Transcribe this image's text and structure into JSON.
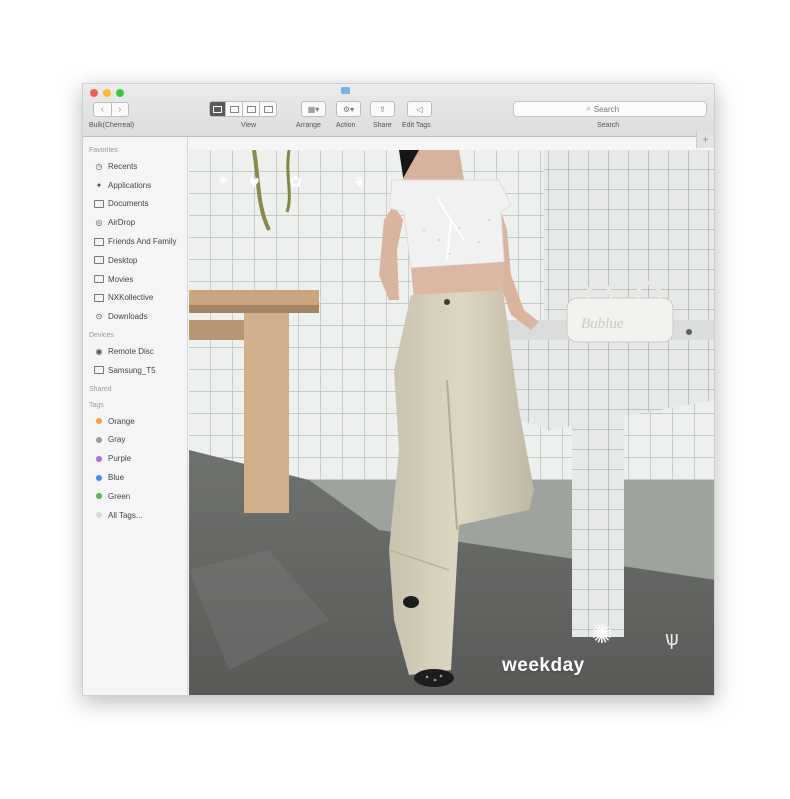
{
  "window": {
    "title": "Bulk(Cherreal)",
    "nav_back": "‹",
    "nav_forward": "›"
  },
  "toolbar": {
    "view_label": "View",
    "arrange_label": "Arrange",
    "action_label": "Action",
    "share_label": "Share",
    "edit_tags_label": "Edit Tags",
    "search_label": "Search",
    "search_placeholder": "Search"
  },
  "sidebar": {
    "favorites_header": "Favorites",
    "favorites": [
      {
        "label": "Recents",
        "icon": "clock-icon"
      },
      {
        "label": "Applications",
        "icon": "applications-icon"
      },
      {
        "label": "Documents",
        "icon": "documents-icon"
      },
      {
        "label": "AirDrop",
        "icon": "airdrop-icon"
      },
      {
        "label": "Friends And Family",
        "icon": "folder-icon"
      },
      {
        "label": "Desktop",
        "icon": "desktop-icon"
      },
      {
        "label": "Movies",
        "icon": "movies-icon"
      },
      {
        "label": "NXKollective",
        "icon": "folder-icon"
      },
      {
        "label": "Downloads",
        "icon": "downloads-icon"
      }
    ],
    "devices_header": "Devices",
    "devices": [
      {
        "label": "Remote Disc",
        "icon": "disc-icon"
      },
      {
        "label": "Samsung_T5",
        "icon": "drive-icon"
      }
    ],
    "shared_header": "Shared",
    "tags_header": "Tags",
    "tags": [
      {
        "label": "Orange",
        "color": "#f0a33a"
      },
      {
        "label": "Gray",
        "color": "#9a9a9a"
      },
      {
        "label": "Purple",
        "color": "#b66bd6"
      },
      {
        "label": "Blue",
        "color": "#3d8ee6"
      },
      {
        "label": "Green",
        "color": "#4dbb4f"
      },
      {
        "label": "All Tags...",
        "color": "#d8d8d8"
      }
    ]
  },
  "content": {
    "watermark_tag": "weekday",
    "bag_text": "Bublue"
  }
}
